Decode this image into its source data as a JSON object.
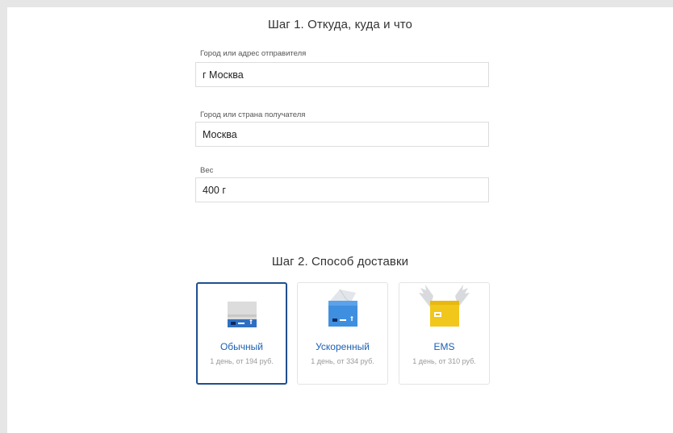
{
  "step1": {
    "title": "Шаг 1. Откуда, куда и что",
    "sender": {
      "label": "Город или адрес отправителя",
      "value": "г Москва"
    },
    "recipient": {
      "label": "Город или страна получателя",
      "value": "Москва"
    },
    "weight": {
      "label": "Вес",
      "value": "400 г"
    }
  },
  "step2": {
    "title": "Шаг 2. Способ доставки",
    "options": [
      {
        "name": "Обычный",
        "desc": "1 день, от 194 руб.",
        "selected": true,
        "icon": "regular-parcel-icon"
      },
      {
        "name": "Ускоренный",
        "desc": "1 день, от 334 руб.",
        "selected": false,
        "icon": "express-parcel-icon"
      },
      {
        "name": "EMS",
        "desc": "1 день, от 310 руб.",
        "selected": false,
        "icon": "ems-winged-parcel-icon"
      }
    ]
  },
  "colors": {
    "accent": "#1f4f8f",
    "link": "#1a5fb4",
    "ems_yellow": "#f2c71b",
    "express_blue": "#3f8fe0"
  }
}
